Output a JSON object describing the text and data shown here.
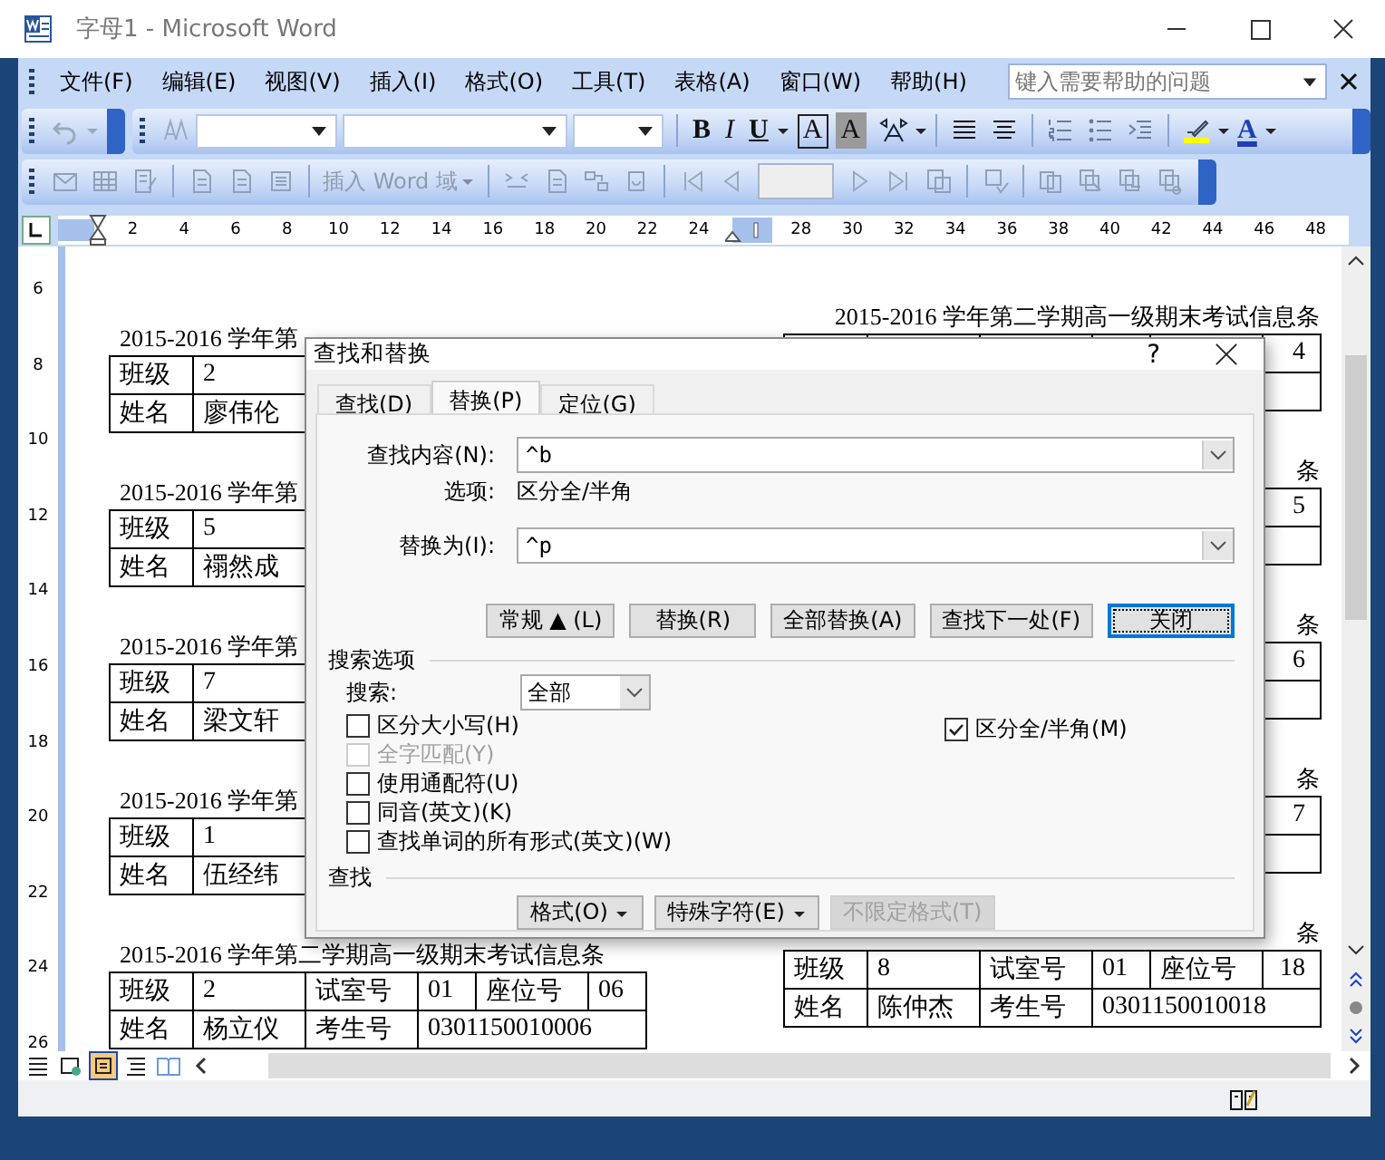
{
  "window": {
    "title": "字母1 - Microsoft Word"
  },
  "menu": [
    "文件(F)",
    "编辑(E)",
    "视图(V)",
    "插入(I)",
    "格式(O)",
    "工具(T)",
    "表格(A)",
    "窗口(W)",
    "帮助(H)"
  ],
  "help_field": {
    "placeholder": "键入需要帮助的问题"
  },
  "formatting": {
    "bold": "B",
    "italic": "I",
    "underline": "U",
    "boxed": "A",
    "shaded": "A",
    "font_color": "A"
  },
  "insert_field": {
    "label": "插入 Word 域",
    "disabled": true
  },
  "ruler": [
    {
      "kind": "number",
      "text": "2"
    },
    {
      "kind": "number",
      "text": "4"
    },
    {
      "kind": "number",
      "text": "6"
    },
    {
      "kind": "number",
      "text": "8"
    },
    {
      "kind": "number",
      "text": "10"
    },
    {
      "kind": "number",
      "text": "12"
    },
    {
      "kind": "number",
      "text": "14"
    },
    {
      "kind": "number",
      "text": "16"
    },
    {
      "kind": "number",
      "text": "18"
    },
    {
      "kind": "number",
      "text": "20"
    },
    {
      "kind": "number",
      "text": "22"
    },
    {
      "kind": "number",
      "text": "24"
    },
    {
      "kind": "column_marker"
    },
    {
      "kind": "number",
      "text": "28"
    },
    {
      "kind": "number",
      "text": "30"
    },
    {
      "kind": "number",
      "text": "32"
    },
    {
      "kind": "number",
      "text": "34"
    },
    {
      "kind": "number",
      "text": "36"
    },
    {
      "kind": "number",
      "text": "38"
    },
    {
      "kind": "number",
      "text": "40"
    },
    {
      "kind": "number",
      "text": "42"
    },
    {
      "kind": "number",
      "text": "44"
    },
    {
      "kind": "number",
      "text": "46"
    },
    {
      "kind": "number",
      "text": "48"
    }
  ],
  "vertical_ruler": [
    "6",
    "8",
    "10",
    "12",
    "14",
    "16",
    "18",
    "20",
    "22",
    "24",
    "26"
  ],
  "document": {
    "left": [
      {
        "title": "2015-2016 学年第",
        "class_label": "班级",
        "class": "2",
        "name_label": "姓名",
        "name": "廖伟伦"
      },
      {
        "title": "2015-2016 学年第",
        "class_label": "班级",
        "class": "5",
        "name_label": "姓名",
        "name": "禤然成"
      },
      {
        "title": "2015-2016 学年第",
        "class_label": "班级",
        "class": "7",
        "name_label": "姓名",
        "name": "梁文轩"
      },
      {
        "title": "2015-2016 学年第",
        "class_label": "班级",
        "class": "1",
        "name_label": "姓名",
        "name": "伍经纬"
      },
      {
        "title": "2015-2016 学年第二学期高一级期末考试信息条",
        "class_label": "班级",
        "class": "2",
        "room_label": "试室号",
        "room": "01",
        "seat_label": "座位号",
        "seat": "06",
        "name_label": "姓名",
        "name": "杨立仪",
        "id_label": "考生号",
        "id": "0301150010006"
      }
    ],
    "right": [
      {
        "title": "2015-2016 学年第二学期高一级期末考试信息条",
        "seat": "4"
      },
      {
        "title": "条",
        "seat": "5"
      },
      {
        "title": "条",
        "seat": "6"
      },
      {
        "title": "条",
        "seat": "7"
      },
      {
        "title": "条",
        "class_label": "班级",
        "class": "8",
        "room_label": "试室号",
        "room": "01",
        "seat_label": "座位号",
        "seat": "18",
        "name_label": "姓名",
        "name": "陈仲杰",
        "id_label": "考生号",
        "id": "0301150010018"
      }
    ]
  },
  "dialog": {
    "title": "查找和替换",
    "help": "?",
    "tabs": [
      {
        "label": "查找(D)",
        "selected": false
      },
      {
        "label": "替换(P)",
        "selected": true
      },
      {
        "label": "定位(G)",
        "selected": false
      }
    ],
    "find": {
      "label": "查找内容(N):",
      "value": "^b"
    },
    "options": {
      "label": "选项:",
      "value": "区分全/半角"
    },
    "replace": {
      "label": "替换为(I):",
      "value": "^p"
    },
    "buttons": [
      {
        "label": "常规 ▲ (L)",
        "focused": false
      },
      {
        "label": "替换(R)",
        "focused": false
      },
      {
        "label": "全部替换(A)",
        "focused": false
      },
      {
        "label": "查找下一处(F)",
        "focused": false
      },
      {
        "label": "关闭",
        "focused": true
      }
    ],
    "search_heading": "搜索选项",
    "search": {
      "label": "搜索:",
      "value": "全部"
    },
    "checkboxes": [
      {
        "label": "区分大小写(H)",
        "checked": false,
        "disabled": false
      },
      {
        "label": "全字匹配(Y)",
        "checked": false,
        "disabled": true
      },
      {
        "label": "使用通配符(U)",
        "checked": false,
        "disabled": false
      },
      {
        "label": "同音(英文)(K)",
        "checked": false,
        "disabled": false
      },
      {
        "label": "查找单词的所有形式(英文)(W)",
        "checked": false,
        "disabled": false
      }
    ],
    "right_checkbox": {
      "label": "区分全/半角(M)",
      "checked": true,
      "disabled": false
    },
    "find_heading": "查找",
    "bottom_buttons": [
      {
        "label": "格式(O)",
        "dropdown": true,
        "disabled": false
      },
      {
        "label": "特殊字符(E)",
        "dropdown": true,
        "disabled": false
      },
      {
        "label": "不限定格式(T)",
        "dropdown": false,
        "disabled": true
      }
    ]
  }
}
